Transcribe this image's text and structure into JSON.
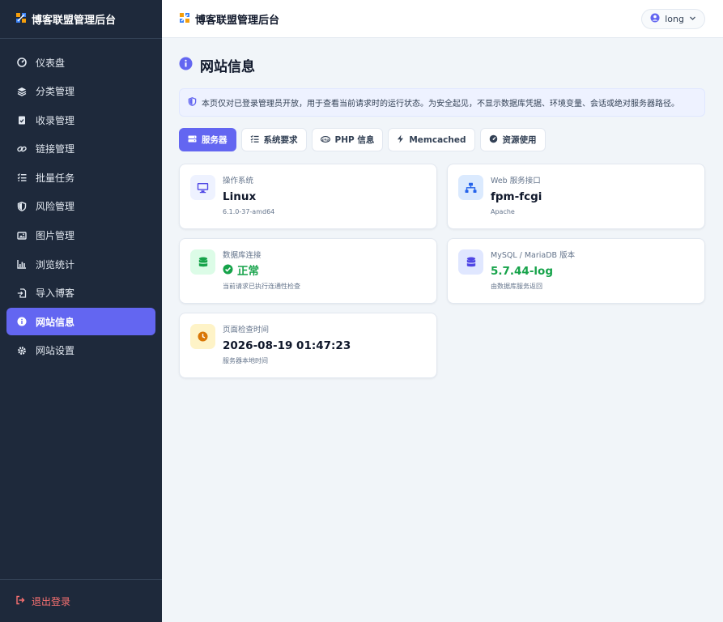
{
  "app": {
    "brand": "博客联盟管理后台"
  },
  "sidebar": {
    "items": [
      {
        "label": "仪表盘",
        "icon": "gauge-icon"
      },
      {
        "label": "分类管理",
        "icon": "layers-icon"
      },
      {
        "label": "收录管理",
        "icon": "clipboard-check-icon"
      },
      {
        "label": "链接管理",
        "icon": "link-icon"
      },
      {
        "label": "批量任务",
        "icon": "list-check-icon"
      },
      {
        "label": "风险管理",
        "icon": "shield-icon"
      },
      {
        "label": "图片管理",
        "icon": "images-icon"
      },
      {
        "label": "浏览统计",
        "icon": "bar-chart-icon"
      },
      {
        "label": "导入博客",
        "icon": "file-import-icon"
      },
      {
        "label": "网站信息",
        "icon": "info-circle-icon",
        "active": true
      },
      {
        "label": "网站设置",
        "icon": "gear-icon"
      }
    ],
    "logout": "退出登录"
  },
  "header": {
    "title": "博客联盟管理后台",
    "user": "long"
  },
  "page": {
    "title": "网站信息",
    "notice": "本页仅对已登录管理员开放，用于查看当前请求时的运行状态。为安全起见，不显示数据库凭据、环境变量、会话或绝对服务器路径。"
  },
  "tabs": [
    {
      "label": "服务器",
      "icon": "server-icon",
      "active": true
    },
    {
      "label": "系统要求",
      "icon": "list-check-icon"
    },
    {
      "label": "PHP 信息",
      "icon": "php-icon"
    },
    {
      "label": "Memcached",
      "icon": "bolt-icon"
    },
    {
      "label": "资源使用",
      "icon": "gauge-icon"
    }
  ],
  "cards": {
    "os": {
      "label": "操作系统",
      "value": "Linux",
      "sub": "6.1.0-37-amd64",
      "icon": "monitor-icon"
    },
    "web": {
      "label": "Web 服务接口",
      "value": "fpm-fcgi",
      "sub": "Apache",
      "icon": "network-icon"
    },
    "db": {
      "label": "数据库连接",
      "value": "正常",
      "sub": "当前请求已执行连通性检查",
      "icon": "database-icon"
    },
    "mysql": {
      "label": "MySQL / MariaDB 版本",
      "value": "5.7.44-log",
      "sub": "由数据库服务返回",
      "icon": "database-icon"
    },
    "time": {
      "label": "页面检查时间",
      "value": "2026-08-19 01:47:23",
      "sub": "服务器本地时间",
      "icon": "clock-icon"
    }
  },
  "colors": {
    "accent": "#6366f1",
    "sidebar": "#1e293b",
    "success": "#16a34a",
    "danger": "#f87171",
    "warning": "#d97706"
  }
}
